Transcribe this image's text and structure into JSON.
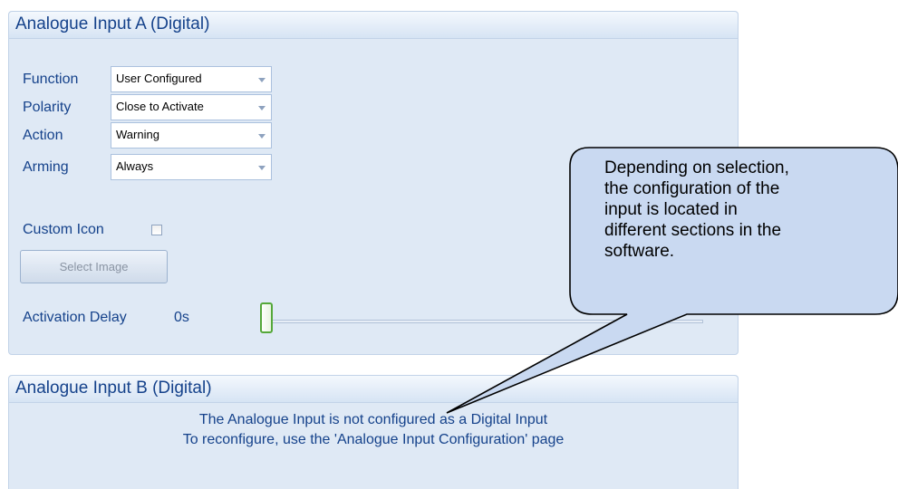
{
  "panel_a": {
    "title": "Analogue Input A (Digital)",
    "fields": [
      {
        "label": "Function",
        "value": "User Configured"
      },
      {
        "label": "Polarity",
        "value": "Close to Activate"
      },
      {
        "label": "Action",
        "value": "Warning"
      },
      {
        "label": "Arming",
        "value": "Always"
      }
    ],
    "custom_icon_label": "Custom Icon",
    "custom_icon_checked": false,
    "select_image_label": "Select Image",
    "activation_delay_label": "Activation Delay",
    "activation_delay_value": "0s"
  },
  "panel_b": {
    "title": "Analogue Input B (Digital)",
    "message_line1": "The Analogue Input is not configured as a Digital Input",
    "message_line2": "To reconfigure, use the 'Analogue Input Configuration' page"
  },
  "callout": {
    "lines": [
      "Depending on selection,",
      "the configuration of the",
      "input is located in",
      "different sections in the",
      "software."
    ]
  },
  "colors": {
    "panel_bg": "#dfe9f5",
    "label_text": "#15428b",
    "callout_fill": "#c9d9f1",
    "slider_thumb": "#55a83a"
  }
}
